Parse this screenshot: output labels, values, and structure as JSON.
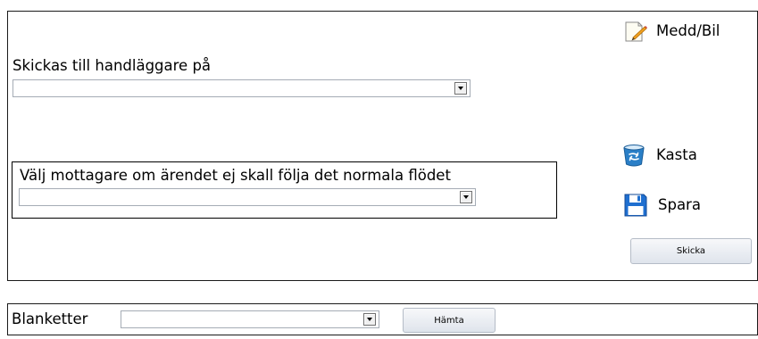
{
  "form": {
    "skickas_label": "Skickas till handläggare på",
    "skickas_value": "",
    "mottagare_label": "Välj mottagare om ärendet ej skall följa det normala flödet",
    "mottagare_value": ""
  },
  "actions": {
    "medd_bil": "Medd/Bil",
    "kasta": "Kasta",
    "spara": "Spara",
    "skicka": "Skicka"
  },
  "blanketter": {
    "label": "Blanketter",
    "value": "",
    "hamta": "Hämta"
  },
  "icons": {
    "medd_bil": "note-pencil-icon",
    "kasta": "trash-bin-icon",
    "spara": "floppy-disk-icon"
  },
  "colors": {
    "button_bg_top": "#f7f8fa",
    "button_bg_bottom": "#dfe4ec",
    "trash_blue": "#2a7fc7",
    "floppy_blue": "#1f6fd0",
    "pencil_orange": "#f0a020"
  }
}
